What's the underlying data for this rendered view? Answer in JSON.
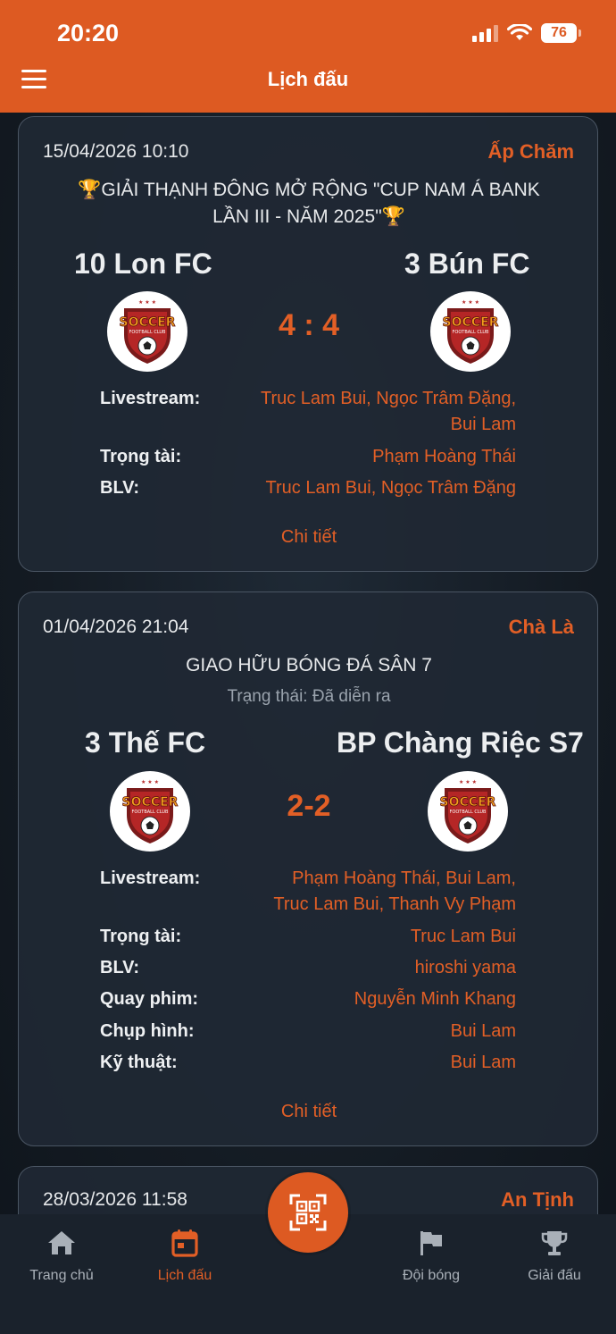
{
  "status_bar": {
    "time": "20:20",
    "battery": "76"
  },
  "header": {
    "title": "Lịch đấu"
  },
  "matches": [
    {
      "datetime": "15/04/2026 10:10",
      "venue": "Ấp Chăm",
      "tournament_line1": "🏆GIẢI THẠNH ĐÔNG MỞ RỘNG \"CUP NAM Á BANK",
      "tournament_line2": "LẦN III - NĂM 2025\"🏆",
      "home_team": "10 Lon FC",
      "away_team": "3 Bún FC",
      "score": "4 : 4",
      "labels": {
        "livestream": "Livestream:",
        "referee": "Trọng tài:",
        "commentator": "BLV:"
      },
      "livestream_line1": "Truc Lam Bui, Ngọc Trâm Đặng,",
      "livestream_line2": "Bui Lam",
      "referee": "Phạm Hoàng Thái",
      "commentator": "Truc Lam Bui, Ngọc Trâm Đặng",
      "detail_link": "Chi tiết"
    },
    {
      "datetime": "01/04/2026 21:04",
      "venue": "Chà Là",
      "tournament_line1": "GIAO HỮU BÓNG ĐÁ SÂN 7",
      "status": "Trạng thái: Đã diễn ra",
      "home_team": "3 Thế FC",
      "away_team": "BP Chàng Riệc S7",
      "score": "2-2",
      "labels": {
        "livestream": "Livestream:",
        "referee": "Trọng tài:",
        "commentator": "BLV:",
        "camera": "Quay phim:",
        "photo": "Chụp hình:",
        "tech": "Kỹ thuật:"
      },
      "livestream_line1": "Phạm Hoàng Thái, Bui Lam,",
      "livestream_line2": "Truc Lam Bui, Thanh Vy Phạm",
      "referee": "Truc Lam Bui",
      "commentator": "hiroshi yama",
      "camera": "Nguyễn Minh Khang",
      "photo": "Bui Lam",
      "tech": "Bui Lam",
      "detail_link": "Chi tiết"
    },
    {
      "datetime": "28/03/2026 11:58",
      "venue": "An Tịnh"
    }
  ],
  "logo_text": "SOCCER",
  "logo_subtext": "FOOTBALL CLUB",
  "tabbar": {
    "items": [
      {
        "label": "Trang chủ",
        "icon": "home-icon"
      },
      {
        "label": "Lịch đấu",
        "icon": "calendar-icon"
      },
      {
        "label": "Đội bóng",
        "icon": "flag-icon"
      },
      {
        "label": "Giải đấu",
        "icon": "trophy-icon"
      }
    ],
    "center_icon": "qr-scan-icon"
  },
  "colors": {
    "accent": "#dd5a22",
    "card_bg": "#1f2834",
    "text_orange": "#e25f26"
  }
}
